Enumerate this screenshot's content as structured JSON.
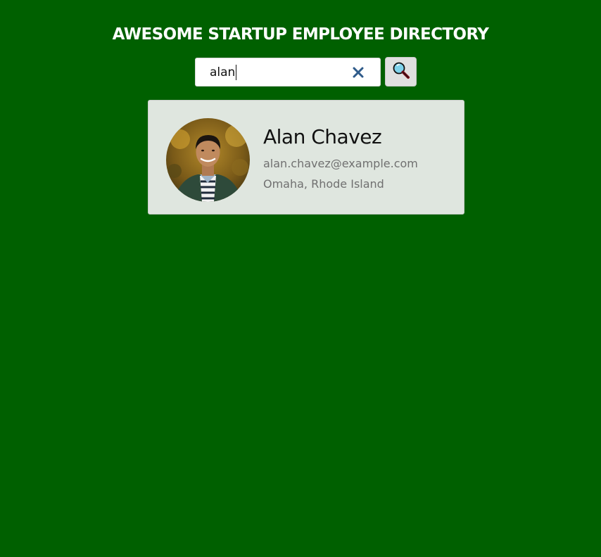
{
  "header": {
    "title": "AWESOME STARTUP EMPLOYEE DIRECTORY"
  },
  "search": {
    "value": "alan",
    "clear_icon": "close-x-icon",
    "button_icon": "magnifying-glass-icon"
  },
  "results": [
    {
      "name": "Alan Chavez",
      "email": "alan.chavez@example.com",
      "location": "Omaha, Rhode Island"
    }
  ],
  "colors": {
    "background": "#006000",
    "card": "#dfe6df",
    "clear_icon": "#2f5b8a"
  }
}
